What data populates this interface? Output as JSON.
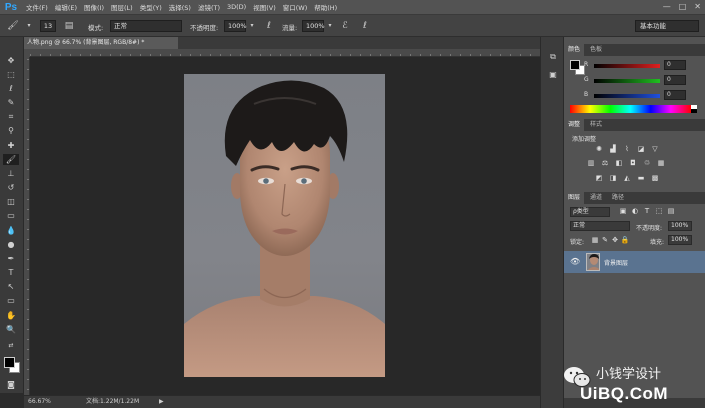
{
  "app": {
    "logo": "Ps"
  },
  "menu": [
    "文件(F)",
    "编辑(E)",
    "图像(I)",
    "图层(L)",
    "类型(Y)",
    "选择(S)",
    "滤镜(T)",
    "3D(D)",
    "视图(V)",
    "窗口(W)",
    "帮助(H)"
  ],
  "window_controls": {
    "minimize": "—",
    "restore": "□",
    "close": "✕"
  },
  "options": {
    "brush_size": "13",
    "mode_label": "模式:",
    "mode_value": "正常",
    "opacity_label": "不透明度:",
    "opacity_value": "100%",
    "flow_label": "流量:",
    "flow_value": "100%",
    "workspace": "基本功能"
  },
  "document": {
    "tab_title": "人物.png @ 66.7% (背景图层, RGB/8#) *",
    "zoom": "66.67%",
    "info": "文档:1.22M/1.22M"
  },
  "color_panel": {
    "tabs": [
      "颜色",
      "色板"
    ],
    "r_label": "R",
    "g_label": "G",
    "b_label": "B",
    "r_value": "0",
    "g_value": "0",
    "b_value": "0",
    "colors": {
      "r": "#e02020",
      "g": "#20c020",
      "b": "#2050e0"
    }
  },
  "adjust_panel": {
    "tabs": [
      "调整",
      "样式"
    ],
    "title": "添加调整"
  },
  "layers_panel": {
    "tabs": [
      "图层",
      "通道",
      "路径"
    ],
    "filter": "ρ类型",
    "blend_mode": "正常",
    "opacity_label": "不透明度:",
    "opacity_value": "100%",
    "lock_label": "锁定:",
    "fill_label": "填充:",
    "fill_value": "100%",
    "layer_name": "背景图层"
  },
  "watermark": {
    "site_cn": "小钱学设计",
    "site_url": "UiBQ.CoM"
  },
  "accent_color": "#5a7390"
}
